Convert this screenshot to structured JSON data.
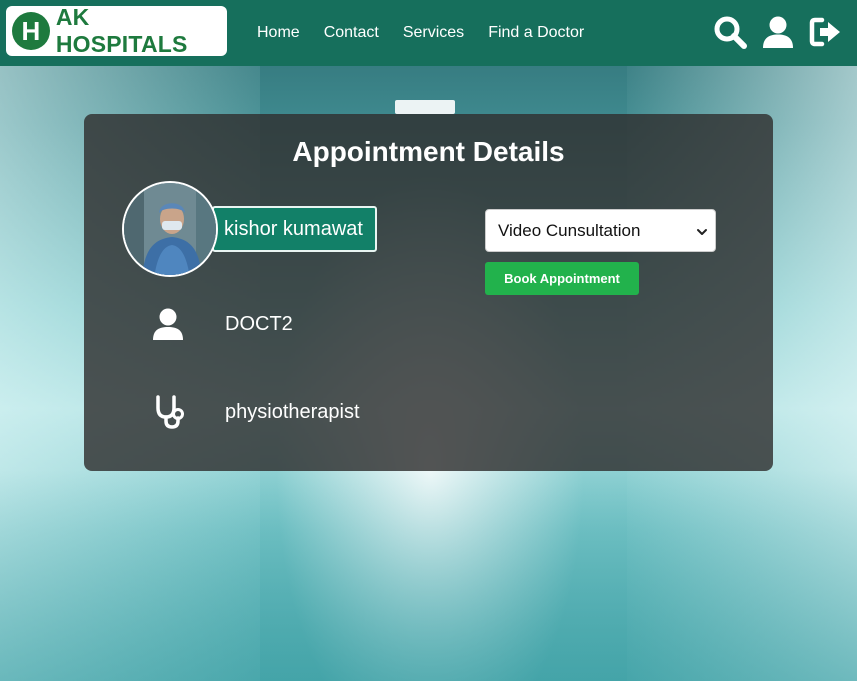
{
  "brand": {
    "badge_letter": "H",
    "name": "AK HOSPITALS",
    "color": "#1e7a3e"
  },
  "nav": {
    "background": "#166f5c",
    "links": [
      "Home",
      "Contact",
      "Services",
      "Find a Doctor"
    ],
    "icons": [
      "search-icon",
      "user-icon",
      "logout-icon"
    ]
  },
  "card": {
    "title": "Appointment Details",
    "doctor_name": "kishor kumawat",
    "doctor_id": "DOCT2",
    "specialty": "physiotherapist",
    "consultation": {
      "selected": "Video Cunsultation"
    },
    "book_button": "Book Appointment",
    "book_button_color": "#22b24c"
  }
}
